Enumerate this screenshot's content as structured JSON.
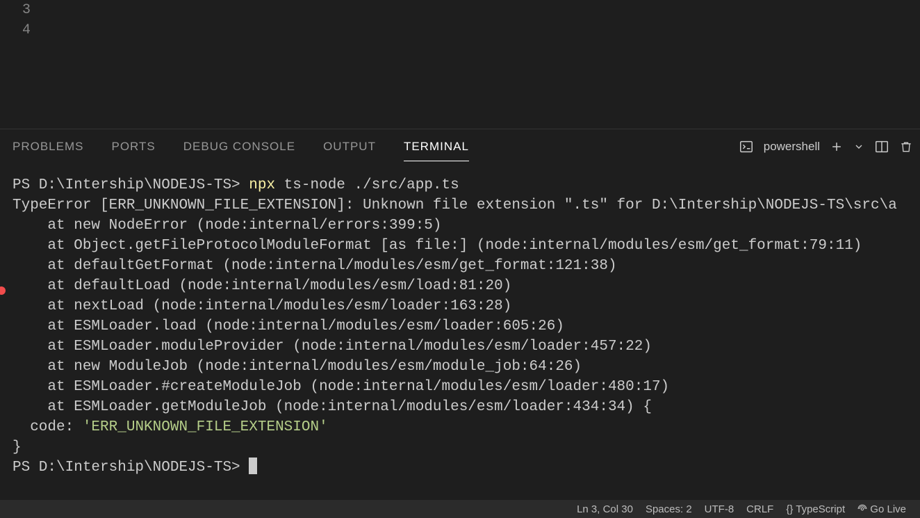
{
  "editor": {
    "line3": "3",
    "line4": "4"
  },
  "panel": {
    "tabs": {
      "problems": "PROBLEMS",
      "ports": "PORTS",
      "debug_console": "DEBUG CONSOLE",
      "output": "OUTPUT",
      "terminal": "TERMINAL"
    },
    "shell": "powershell"
  },
  "terminal": {
    "prompt1": "PS D:\\Intership\\NODEJS-TS> ",
    "cmd_npx": "npx",
    "cmd_rest": " ts-node ./src/app.ts",
    "err_head": "TypeError [ERR_UNKNOWN_FILE_EXTENSION]: Unknown file extension \".ts\" for D:\\Intership\\NODEJS-TS\\src\\a",
    "trace": [
      "    at new NodeError (node:internal/errors:399:5)",
      "    at Object.getFileProtocolModuleFormat [as file:] (node:internal/modules/esm/get_format:79:11)",
      "    at defaultGetFormat (node:internal/modules/esm/get_format:121:38)",
      "    at defaultLoad (node:internal/modules/esm/load:81:20)",
      "    at nextLoad (node:internal/modules/esm/loader:163:28)",
      "    at ESMLoader.load (node:internal/modules/esm/loader:605:26)",
      "    at ESMLoader.moduleProvider (node:internal/modules/esm/loader:457:22)",
      "    at new ModuleJob (node:internal/modules/esm/module_job:64:26)",
      "    at ESMLoader.#createModuleJob (node:internal/modules/esm/loader:480:17)",
      "    at ESMLoader.getModuleJob (node:internal/modules/esm/loader:434:34) {"
    ],
    "code_line_label": "  code: ",
    "code_line_value": "'ERR_UNKNOWN_FILE_EXTENSION'",
    "close_brace": "}",
    "prompt2": "PS D:\\Intership\\NODEJS-TS> "
  },
  "status": {
    "lncol": "Ln 3, Col 30",
    "spaces": "Spaces: 2",
    "encoding": "UTF-8",
    "eol": "CRLF",
    "lang": "{}  TypeScript",
    "golive": "Go Live"
  }
}
